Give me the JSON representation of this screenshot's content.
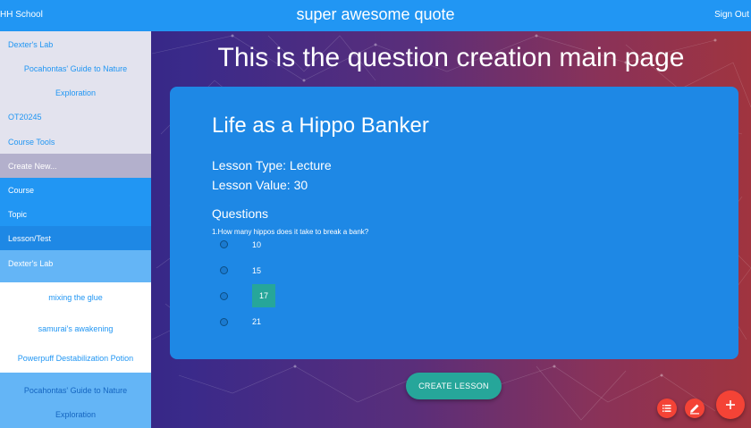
{
  "header": {
    "school": "HH School",
    "title": "super awesome quote",
    "sign_out": "Sign Out"
  },
  "sidebar": {
    "items": [
      {
        "label": "Dexter's Lab"
      },
      {
        "label": "Pocahontas' Guide to Nature"
      },
      {
        "label": "Exploration"
      },
      {
        "label": "OT20245"
      },
      {
        "label": "Course Tools"
      },
      {
        "label": "Create New..."
      },
      {
        "label": "Course"
      },
      {
        "label": "Topic"
      },
      {
        "label": "Lesson/Test"
      },
      {
        "label": "Dexter's Lab"
      },
      {
        "label": "mixing the glue"
      },
      {
        "label": "samurai's awakening"
      },
      {
        "label": "Powerpuff Destabilization Potion"
      },
      {
        "label": "Pocahontas' Guide to Nature"
      },
      {
        "label": "Exploration"
      }
    ]
  },
  "main": {
    "heading": "This is the question creation main page",
    "lesson": {
      "title": "Life as a Hippo Banker",
      "type": "Lesson Type: Lecture",
      "value": "Lesson Value: 30",
      "questions_heading": "Questions",
      "question": "1.How many hippos does it take to break a bank?",
      "options": [
        "10",
        "15",
        "17",
        "21"
      ],
      "correct_option": "17"
    },
    "create_button": "CREATE LESSON"
  },
  "fabs": {
    "list_icon": "list-icon",
    "edit_icon": "pencil-icon",
    "add_icon": "plus-icon",
    "add_label": "+",
    "color": "#f44336"
  },
  "colors": {
    "primary": "#2196f3",
    "card": "#1e88e5",
    "accent": "#26a69a"
  }
}
